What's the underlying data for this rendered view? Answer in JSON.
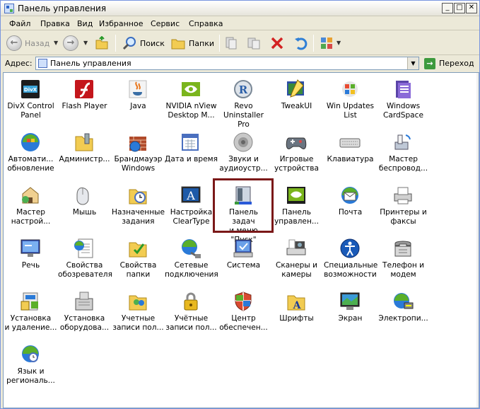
{
  "window": {
    "title": "Панель управления"
  },
  "caption_buttons": [
    "_",
    "□",
    "✕"
  ],
  "menu": [
    "Файл",
    "Правка",
    "Вид",
    "Избранное",
    "Сервис",
    "Справка"
  ],
  "toolbar": {
    "back_label": "Назад",
    "search_label": "Поиск",
    "folders_label": "Папки"
  },
  "address": {
    "label": "Адрес:",
    "value": "Панель управления",
    "go_label": "Переход"
  },
  "items": [
    {
      "label": "DivX Control\nPanel",
      "icon": "divx-icon"
    },
    {
      "label": "Flash Player",
      "icon": "flash-icon"
    },
    {
      "label": "Java",
      "icon": "java-icon"
    },
    {
      "label": "NVIDIA nView\nDesktop M...",
      "icon": "nvidia-icon"
    },
    {
      "label": "Revo\nUninstaller Pro",
      "icon": "revo-icon"
    },
    {
      "label": "TweakUI",
      "icon": "tweakui-icon"
    },
    {
      "label": "Win Updates\nList",
      "icon": "win-updates-icon"
    },
    {
      "label": "Windows\nCardSpace",
      "icon": "cardspace-icon"
    },
    {
      "label": "Автомати...\nобновление",
      "icon": "auto-update-icon"
    },
    {
      "label": "Администр...",
      "icon": "admin-tools-icon"
    },
    {
      "label": "Брандмауэр\nWindows",
      "icon": "firewall-icon"
    },
    {
      "label": "Дата и время",
      "icon": "date-time-icon"
    },
    {
      "label": "Звуки и\nаудиоустр...",
      "icon": "sound-icon"
    },
    {
      "label": "Игровые\nустройства",
      "icon": "gamepad-icon"
    },
    {
      "label": "Клавиатура",
      "icon": "keyboard-icon"
    },
    {
      "label": "Мастер\nбеспровод...",
      "icon": "wireless-icon"
    },
    {
      "label": "Мастер\nнастрой...",
      "icon": "network-wizard-icon"
    },
    {
      "label": "Мышь",
      "icon": "mouse-icon"
    },
    {
      "label": "Назначенные\nзадания",
      "icon": "scheduled-tasks-icon"
    },
    {
      "label": "Настройка\nClearType",
      "icon": "cleartype-icon"
    },
    {
      "label": "Панель задач\nи меню \"Пуск\"",
      "icon": "taskbar-icon"
    },
    {
      "label": "Панель\nуправлен...",
      "icon": "nvidia-panel-icon"
    },
    {
      "label": "Почта",
      "icon": "mail-icon"
    },
    {
      "label": "Принтеры и\nфаксы",
      "icon": "printer-icon"
    },
    {
      "label": "Речь",
      "icon": "speech-icon"
    },
    {
      "label": "Свойства\nобозревателя",
      "icon": "internet-options-icon"
    },
    {
      "label": "Свойства\nпапки",
      "icon": "folder-options-icon"
    },
    {
      "label": "Сетевые\nподключения",
      "icon": "network-icon"
    },
    {
      "label": "Система",
      "icon": "system-icon"
    },
    {
      "label": "Сканеры и\nкамеры",
      "icon": "scanner-icon"
    },
    {
      "label": "Специальные\nвозможности",
      "icon": "accessibility-icon"
    },
    {
      "label": "Телефон и\nмодем",
      "icon": "phone-icon"
    },
    {
      "label": "Установка\nи удаление...",
      "icon": "add-remove-icon"
    },
    {
      "label": "Установка\nоборудова...",
      "icon": "add-hardware-icon"
    },
    {
      "label": "Учетные\nзаписи пол...",
      "icon": "user-accounts-icon"
    },
    {
      "label": "Учётные\nзаписи пол...",
      "icon": "user-accounts-2-icon"
    },
    {
      "label": "Центр\nобеспечен...",
      "icon": "security-center-icon"
    },
    {
      "label": "Шрифты",
      "icon": "fonts-icon"
    },
    {
      "label": "Экран",
      "icon": "display-icon"
    },
    {
      "label": "Электропи...",
      "icon": "power-icon"
    },
    {
      "label": "Язык и\nрегиональ...",
      "icon": "regional-icon"
    }
  ]
}
